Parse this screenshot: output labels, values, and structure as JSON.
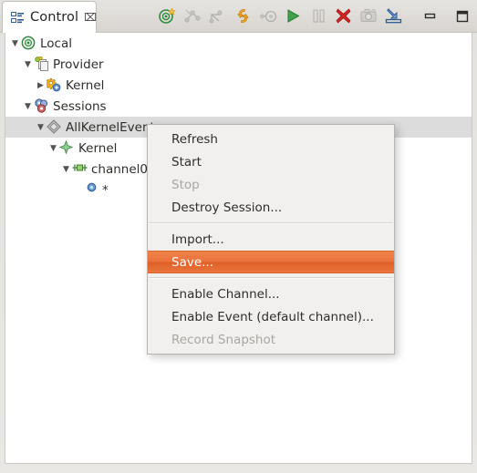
{
  "window": {
    "tab": {
      "label": "Control",
      "icon": "control-view-icon",
      "close_glyph": "⌧"
    },
    "view_buttons": {
      "minimize_label": "Minimize",
      "maximize_label": "Maximize"
    }
  },
  "toolbar": {
    "items": [
      {
        "name": "connect-icon",
        "label": "Connect",
        "enabled": true
      },
      {
        "name": "disconnect-icon",
        "label": "Disconnect",
        "enabled": false
      },
      {
        "name": "new-connection-icon",
        "label": "New Connection",
        "enabled": false
      },
      {
        "name": "refresh-icon",
        "label": "Refresh",
        "enabled": true
      },
      {
        "name": "calibrate-icon",
        "label": "Calibrate",
        "enabled": false
      },
      {
        "name": "start-icon",
        "label": "Start",
        "enabled": true
      },
      {
        "name": "pause-icon",
        "label": "Pause",
        "enabled": false
      },
      {
        "name": "destroy-icon",
        "label": "Destroy",
        "enabled": true
      },
      {
        "name": "snapshot-icon",
        "label": "Record Snapshot",
        "enabled": false
      },
      {
        "name": "import-icon",
        "label": "Import",
        "enabled": true
      },
      {
        "name": "minimize-view-icon",
        "label": "Minimize",
        "enabled": true
      },
      {
        "name": "maximize-view-icon",
        "label": "Maximize",
        "enabled": true
      }
    ]
  },
  "tree": {
    "nodes": [
      {
        "label": "Local",
        "indent": 0,
        "twisty": "▼",
        "icon": "target-icon",
        "selected": false
      },
      {
        "label": "Provider",
        "indent": 1,
        "twisty": "▼",
        "icon": "provider-icon",
        "selected": false
      },
      {
        "label": "Kernel",
        "indent": 2,
        "twisty": "▶",
        "icon": "gears-icon",
        "selected": false
      },
      {
        "label": "Sessions",
        "indent": 1,
        "twisty": "▼",
        "icon": "sessions-icon",
        "selected": false
      },
      {
        "label": "AllKernelEvents",
        "indent": 2,
        "twisty": "▼",
        "icon": "session-icon",
        "selected": true
      },
      {
        "label": "Kernel",
        "indent": 3,
        "twisty": "▼",
        "icon": "domain-icon",
        "selected": false
      },
      {
        "label": "channel0",
        "indent": 4,
        "twisty": "▼",
        "icon": "channel-icon",
        "selected": false
      },
      {
        "label": "*",
        "indent": 5,
        "twisty": "",
        "icon": "event-icon",
        "selected": false
      }
    ]
  },
  "context_menu": {
    "items": [
      {
        "label": "Refresh",
        "type": "item",
        "state": "enabled"
      },
      {
        "label": "Start",
        "type": "item",
        "state": "enabled"
      },
      {
        "label": "Stop",
        "type": "item",
        "state": "disabled"
      },
      {
        "label": "Destroy Session...",
        "type": "item",
        "state": "enabled"
      },
      {
        "label": "",
        "type": "separator",
        "state": ""
      },
      {
        "label": "Import...",
        "type": "item",
        "state": "enabled"
      },
      {
        "label": "Save...",
        "type": "item",
        "state": "highlight"
      },
      {
        "label": "",
        "type": "separator",
        "state": ""
      },
      {
        "label": "Enable Channel...",
        "type": "item",
        "state": "enabled"
      },
      {
        "label": "Enable Event (default channel)...",
        "type": "item",
        "state": "enabled"
      },
      {
        "label": "Record Snapshot",
        "type": "item",
        "state": "disabled"
      }
    ]
  },
  "colors": {
    "highlight": "#e8703a",
    "selection": "#dcdcdc",
    "menu_bg": "#f2f0ee",
    "text": "#2e2d2a",
    "disabled_text": "#a9a6a2"
  }
}
